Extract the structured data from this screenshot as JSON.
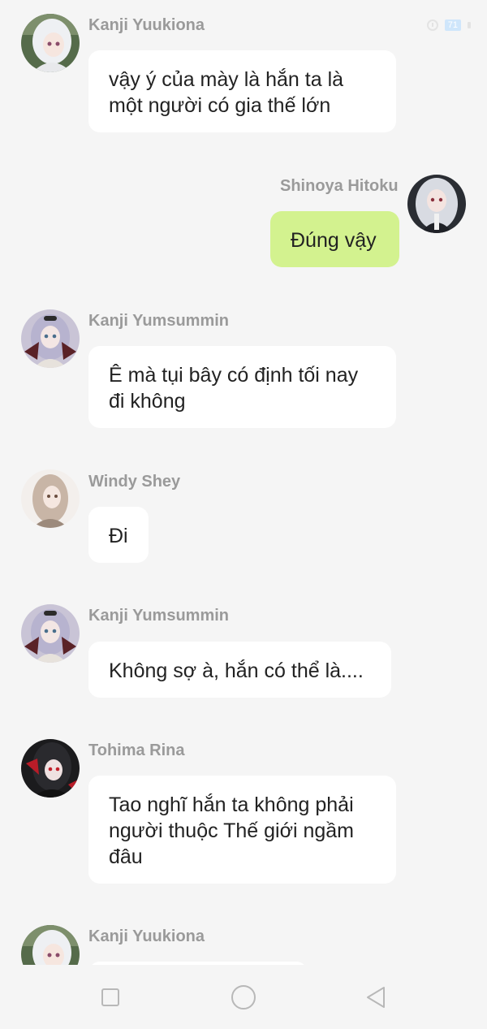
{
  "status_bar": {
    "battery_level": "71",
    "icons": [
      "alarm-icon",
      "battery-icon",
      "signal-icon"
    ]
  },
  "messages": [
    {
      "sender": "Kanji Yuukiona",
      "text": "vậy ý của mày là hắn ta là một người có gia thế lớn",
      "own": false,
      "avatar": "white-hair-girl-avatar"
    },
    {
      "sender": "Shinoya Hitoku",
      "text": "Đúng vậy",
      "own": true,
      "avatar": "silver-hair-girl-avatar"
    },
    {
      "sender": "Kanji Yumsummin",
      "text": "Ê mà tụi bây có định tối nay đi không",
      "own": false,
      "avatar": "lavender-hair-girl-avatar"
    },
    {
      "sender": "Windy Shey",
      "text": "Đi",
      "own": false,
      "avatar": "beige-hair-girl-avatar"
    },
    {
      "sender": "Kanji Yumsummin",
      "text": "Không sợ à, hắn có thể là....",
      "own": false,
      "avatar": "lavender-hair-girl-avatar"
    },
    {
      "sender": "Tohima Rina",
      "text": "Tao nghĩ hắn ta không phải người thuộc Thế giới ngầm đâu",
      "own": false,
      "avatar": "dark-hair-girl-avatar"
    },
    {
      "sender": "Kanji Yuukiona",
      "text": "",
      "own": false,
      "avatar": "white-hair-girl-avatar"
    }
  ],
  "navigation": {
    "buttons": [
      "recent-apps",
      "home",
      "back"
    ]
  },
  "colors": {
    "background": "#f5f5f5",
    "own_bubble": "#d3f28f",
    "other_bubble": "#ffffff",
    "sender_name": "#9a9a9a"
  }
}
